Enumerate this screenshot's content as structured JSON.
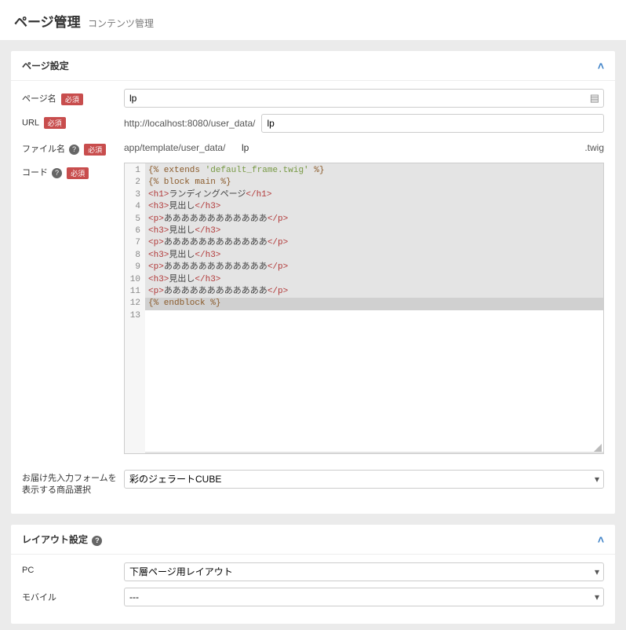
{
  "header": {
    "title": "ページ管理",
    "subtitle": "コンテンツ管理"
  },
  "section_page": {
    "title": "ページ設定",
    "labels": {
      "page_name": "ページ名",
      "url": "URL",
      "file_name": "ファイル名",
      "code": "コード",
      "product_select": "お届け先入力フォームを表示する商品選択",
      "required_badge": "必須"
    },
    "page_name_value": "lp",
    "url_prefix": "http://localhost:8080/user_data/",
    "url_value": "lp",
    "file_prefix": "app/template/user_data/",
    "file_value": "lp",
    "file_suffix": ".twig",
    "product_select_value": "彩のジェラートCUBE",
    "code_lines": [
      {
        "n": 1,
        "segs": [
          [
            "tw",
            "{% extends "
          ],
          [
            "str",
            "'default_frame.twig'"
          ],
          [
            "tw",
            " %}"
          ]
        ]
      },
      {
        "n": 2,
        "segs": [
          [
            "txt",
            ""
          ]
        ]
      },
      {
        "n": 3,
        "segs": [
          [
            "tw",
            "{% block main %}"
          ]
        ]
      },
      {
        "n": 4,
        "segs": [
          [
            "tag",
            "<h1>"
          ],
          [
            "txt",
            "ランディングページ"
          ],
          [
            "tag",
            "</h1>"
          ]
        ]
      },
      {
        "n": 5,
        "segs": [
          [
            "tag",
            "<h3>"
          ],
          [
            "txt",
            "見出し"
          ],
          [
            "tag",
            "</h3>"
          ]
        ]
      },
      {
        "n": 6,
        "segs": [
          [
            "tag",
            "<p>"
          ],
          [
            "txt",
            "ああああああああああああ"
          ],
          [
            "tag",
            "</p>"
          ]
        ]
      },
      {
        "n": 7,
        "segs": [
          [
            "tag",
            "<h3>"
          ],
          [
            "txt",
            "見出し"
          ],
          [
            "tag",
            "</h3>"
          ]
        ]
      },
      {
        "n": 8,
        "segs": [
          [
            "tag",
            "<p>"
          ],
          [
            "txt",
            "ああああああああああああ"
          ],
          [
            "tag",
            "</p>"
          ]
        ]
      },
      {
        "n": 9,
        "segs": [
          [
            "tag",
            "<h3>"
          ],
          [
            "txt",
            "見出し"
          ],
          [
            "tag",
            "</h3>"
          ]
        ]
      },
      {
        "n": 10,
        "segs": [
          [
            "tag",
            "<p>"
          ],
          [
            "txt",
            "ああああああああああああ"
          ],
          [
            "tag",
            "</p>"
          ]
        ]
      },
      {
        "n": 11,
        "segs": [
          [
            "tag",
            "<h3>"
          ],
          [
            "txt",
            "見出し"
          ],
          [
            "tag",
            "</h3>"
          ]
        ]
      },
      {
        "n": 12,
        "segs": [
          [
            "tag",
            "<p>"
          ],
          [
            "txt",
            "ああああああああああああ"
          ],
          [
            "tag",
            "</p>"
          ]
        ]
      },
      {
        "n": 13,
        "segs": [
          [
            "tw",
            "{% endblock %}"
          ]
        ],
        "active": true
      }
    ]
  },
  "section_layout": {
    "title": "レイアウト設定",
    "labels": {
      "pc": "PC",
      "mobile": "モバイル"
    },
    "pc_value": "下層ページ用レイアウト",
    "mobile_value": "---"
  }
}
